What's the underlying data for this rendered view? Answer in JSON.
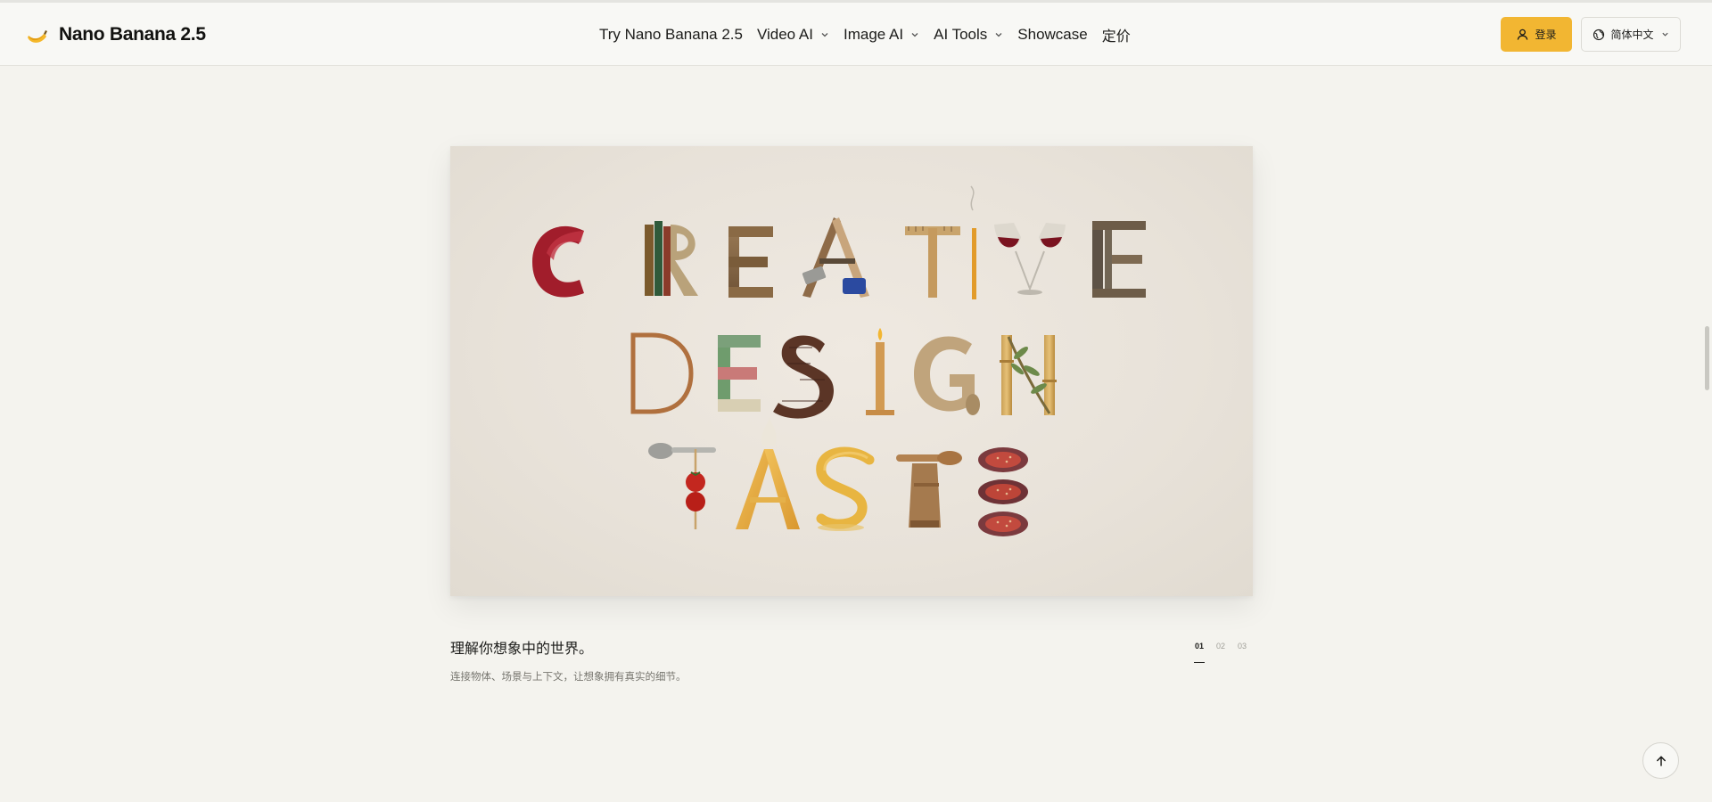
{
  "header": {
    "brand_name": "Nano Banana 2.5",
    "brand_icon": "banana-icon",
    "nav": [
      {
        "label": "Try Nano Banana 2.5",
        "has_dropdown": false
      },
      {
        "label": "Video AI",
        "has_dropdown": true
      },
      {
        "label": "Image AI",
        "has_dropdown": true
      },
      {
        "label": "AI Tools",
        "has_dropdown": true
      },
      {
        "label": "Showcase",
        "has_dropdown": false
      },
      {
        "label": "定价",
        "has_dropdown": false
      }
    ],
    "login_label": "登录",
    "login_icon": "user-icon",
    "language_label": "简体中文",
    "language_icon": "globe-icon"
  },
  "hero": {
    "image_lines": [
      "CREATIVE",
      "DESIGN",
      "TASTE"
    ]
  },
  "caption": {
    "title": "理解你想象中的世界。",
    "subtitle": "连接物体、场景与上下文，让想象拥有真实的细节。"
  },
  "pager": {
    "items": [
      "01",
      "02",
      "03"
    ],
    "active_index": 0
  },
  "back_to_top_icon": "arrow-up-icon",
  "colors": {
    "page_bg": "#f4f3ee",
    "header_bg": "#f8f8f5",
    "accent": "#f2b632",
    "text": "#1c1c1a",
    "muted": "#77766f"
  }
}
